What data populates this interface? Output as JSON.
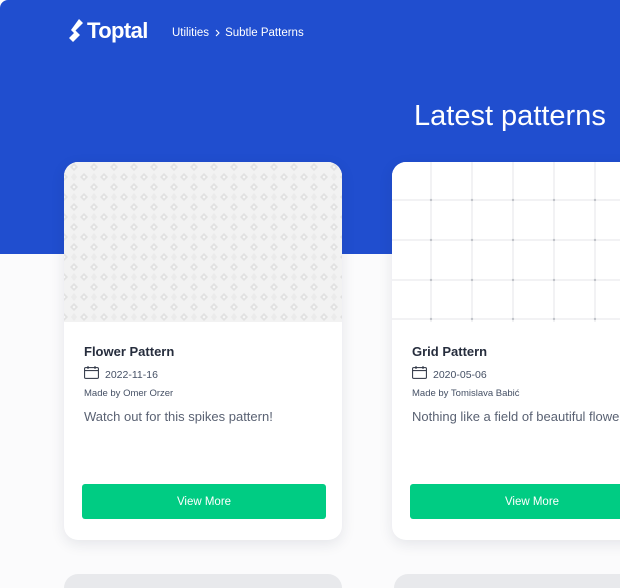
{
  "header": {
    "logo_text": "Toptal",
    "breadcrumb": [
      "Utilities",
      "Subtle Patterns"
    ],
    "headline": "Latest patterns"
  },
  "cards": [
    {
      "title": "Flower Pattern",
      "date": "2022-11-16",
      "author": "Made by Omer Orzer",
      "description": "Watch out for this spikes pattern!",
      "button_label": "View More",
      "preview_icon": "flower-pattern-preview"
    },
    {
      "title": "Grid Pattern",
      "date": "2020-05-06",
      "author": "Made by Tomislava Babić",
      "description": "Nothing like a field of beautiful flowers",
      "button_label": "View More",
      "preview_icon": "grid-pattern-preview"
    }
  ],
  "colors": {
    "brand_blue": "#204ecf",
    "button_green": "#00cc83",
    "text_dark": "#262d3d"
  }
}
